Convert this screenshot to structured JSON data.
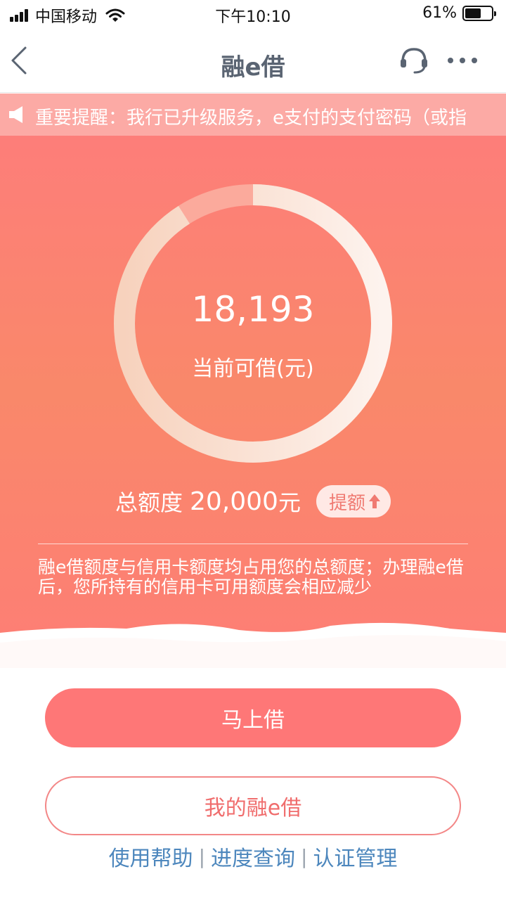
{
  "status_bar": {
    "carrier": "中国移动",
    "time": "下午10:10",
    "battery": "61%",
    "battery_level": 0.61
  },
  "nav": {
    "title": "融e借"
  },
  "notice": {
    "text": "重要提醒：我行已升级服务，e支付的支付密码（或指"
  },
  "loan": {
    "available_amount": "18,193",
    "available_label": "当前可借(元)",
    "used_fraction": 0.0904,
    "total_label": "总额度",
    "total_value": "20,000",
    "total_unit": "元",
    "raise_label": "提额",
    "description": "融e借额度与信用卡额度均占用您的总额度；办理融e借后，您所持有的信用卡可用额度会相应减少"
  },
  "actions": {
    "borrow_now": "马上借",
    "my_loan": "我的融e借"
  },
  "links": {
    "help": "使用帮助",
    "separator": "|",
    "progress": "进度查询",
    "auth": "认证管理"
  },
  "colors": {
    "accent": "#fe7777",
    "link": "#4d87bd",
    "nav_title": "#5a6472"
  }
}
